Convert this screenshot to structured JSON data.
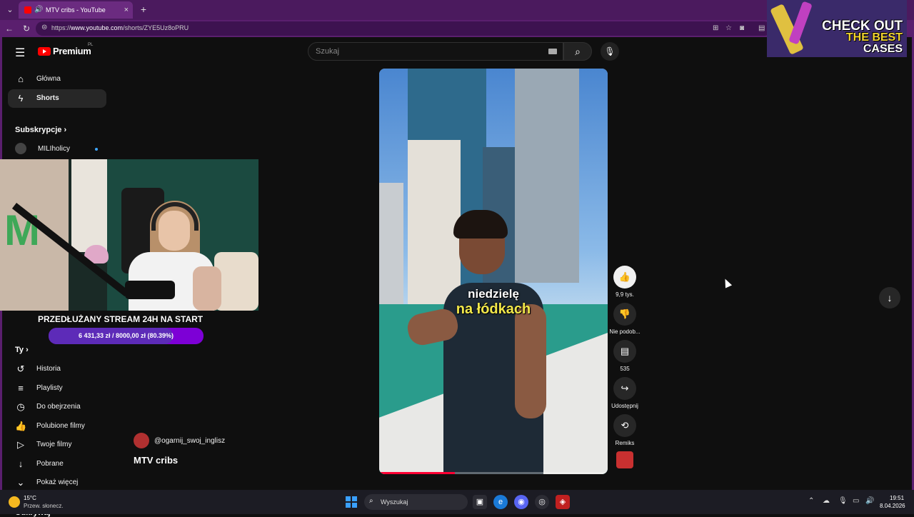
{
  "tab": {
    "title": "MTV cribs - YouTube",
    "close": "×",
    "new": "+"
  },
  "window_controls": {
    "minimize": "–",
    "maximize": "□",
    "close": "×"
  },
  "addressbar": {
    "url_prefix": "https://",
    "url_domain": "www.youtube.com",
    "url_path": "/shorts/ZYE5Uz8oPRU"
  },
  "youtube": {
    "logo_text": "Premium",
    "logo_country": "PL",
    "search_placeholder": "Szukaj"
  },
  "sidebar": {
    "items": [
      {
        "label": "Główna",
        "icon": "home-icon"
      },
      {
        "label": "Shorts",
        "icon": "shorts-icon",
        "active": true
      }
    ],
    "subscriptions_heading": "Subskrypcje",
    "subscription": "MILIholicy",
    "you_heading": "Ty",
    "you_items": [
      {
        "label": "Historia",
        "icon": "history-icon"
      },
      {
        "label": "Playlisty",
        "icon": "playlist-icon"
      },
      {
        "label": "Do obejrzenia",
        "icon": "watch-later-icon"
      },
      {
        "label": "Polubione filmy",
        "icon": "like-icon"
      },
      {
        "label": "Twoje filmy",
        "icon": "your-videos-icon"
      },
      {
        "label": "Pobrane",
        "icon": "download-icon"
      },
      {
        "label": "Pokaż więcej",
        "icon": "chevron-down-icon"
      }
    ],
    "explore_heading": "Odkrywaj"
  },
  "stream_overlay": {
    "title": "PRZEDŁUŻANY STREAM 24H NA START",
    "goal_text": "6 431,33 zł / 8000,00 zł (80.39%)",
    "goal_fraction": 0.8039
  },
  "short": {
    "caption_line1": "niedzielę",
    "caption_line2": "na łódkach",
    "progress_fraction": 0.33,
    "channel": "@ogarnij_swoj_inglisz",
    "title": "MTV cribs"
  },
  "actions": {
    "like_count": "9,9 tys.",
    "dislike_label": "Nie podob...",
    "comments_count": "535",
    "share_label": "Udostępnij",
    "remix_label": "Remiks"
  },
  "ad": {
    "line1": "CHECK OUT",
    "line2": "THE BEST",
    "line3": "CASES"
  },
  "taskbar": {
    "temperature": "15°C",
    "weather": "Przew. słonecz.",
    "search_label": "Wyszukaj",
    "time": "19:51",
    "date": "8.04.2026"
  },
  "colors": {
    "accent_red": "#ff0000",
    "frame": "#5a1f6e",
    "goal_purple": "#7d00d6",
    "caption_yellow": "#f2e84a"
  }
}
